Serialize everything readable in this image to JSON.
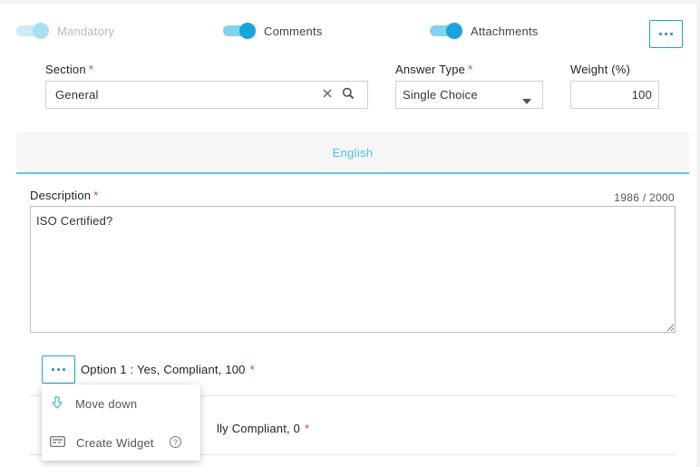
{
  "toggles": [
    {
      "label": "Mandatory",
      "on": true,
      "disabled": true
    },
    {
      "label": "Comments",
      "on": true,
      "disabled": false
    },
    {
      "label": "Attachments",
      "on": true,
      "disabled": false
    }
  ],
  "section": {
    "label": "Section",
    "required": "*",
    "value": "General"
  },
  "answer_type": {
    "label": "Answer Type",
    "required": "*",
    "value": "Single Choice"
  },
  "weight": {
    "label": "Weight (%)",
    "value": "100"
  },
  "language_tab": "English",
  "description": {
    "label": "Description",
    "required": "*",
    "counter": "1986 / 2000",
    "value": "ISO Certified?"
  },
  "options": [
    {
      "label": "Option 1 : Yes, Compliant, 100",
      "required": "*"
    },
    {
      "label_partial": "lly Compliant, 0",
      "required": "*"
    }
  ],
  "context_menu": {
    "items": [
      {
        "label": "Move down",
        "icon": "arrow-down-icon"
      },
      {
        "label": "Create Widget",
        "icon": "widget-card-icon",
        "help": "?"
      }
    ]
  },
  "colors": {
    "accent": "#1aa3dc",
    "required": "#e53935",
    "tab": "#4cc0e6"
  }
}
